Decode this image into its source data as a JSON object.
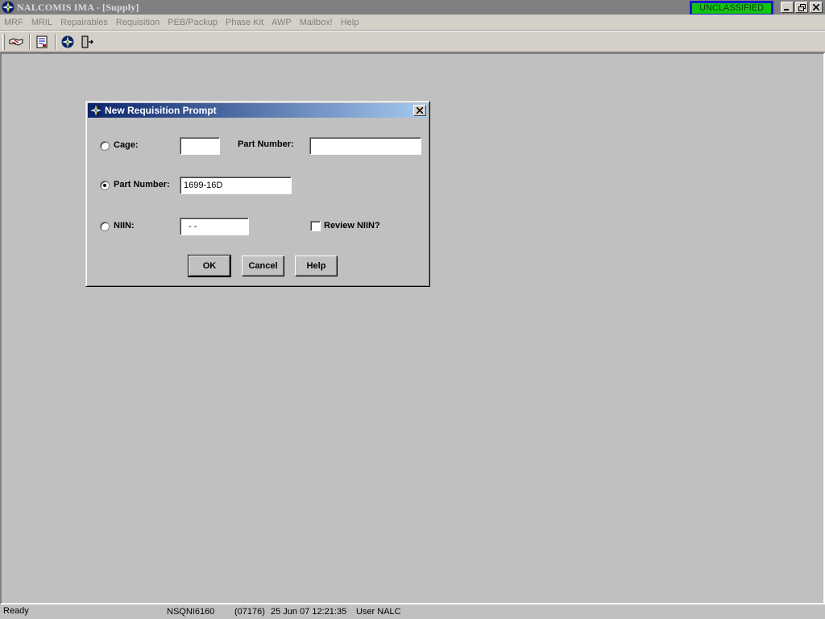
{
  "window": {
    "title": "NALCOMIS IMA - [Supply]",
    "classification": "UNCLASSIFIED",
    "icons": {
      "app": "compass-star-icon",
      "minimize": "minimize-icon",
      "restore": "restore-icon",
      "close": "close-icon"
    }
  },
  "menubar": {
    "items": [
      "MRF",
      "MRIL",
      "Repairables",
      "Requisition",
      "PEB/Packup",
      "Phase Kit",
      "AWP",
      "Mailbox!",
      "Help"
    ]
  },
  "toolbar": {
    "buttons": [
      {
        "name": "handshake-icon"
      },
      {
        "name": "document-list-icon"
      },
      {
        "name": "compass-star-icon"
      },
      {
        "name": "exit-door-icon"
      }
    ]
  },
  "dialog": {
    "title": "New Requisition Prompt",
    "cage_label": "Cage:",
    "cage_value": "",
    "part_number_right_label": "Part Number:",
    "part_number_right_value": "",
    "part_number_label": "Part Number:",
    "part_number_value": "1699-16D",
    "niin_label": "NIIN:",
    "niin_value": "-  -",
    "review_niin_label": "Review NIIN?",
    "review_niin_checked": false,
    "selected_option": "part_number",
    "ok_label": "OK",
    "cancel_label": "Cancel",
    "help_label": "Help"
  },
  "status": {
    "state": "Ready",
    "host": "NSQNI6160",
    "session": "(07176)",
    "datetime": "25 Jun 07  12:21:35",
    "user": "User NALC"
  }
}
